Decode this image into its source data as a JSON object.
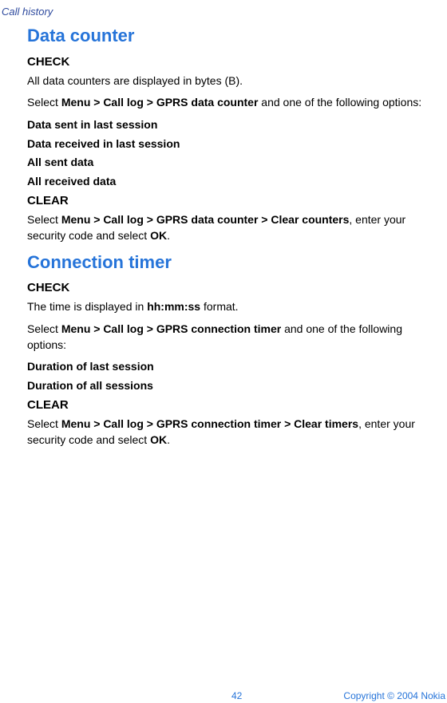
{
  "header": {
    "section": "Call history"
  },
  "s1": {
    "title": "Data counter",
    "check": {
      "heading": "CHECK",
      "body": "All data counters are displayed in bytes (B).",
      "nav_prefix": "Select ",
      "nav_path": "Menu > Call log > GPRS data counter",
      "nav_suffix": " and one of the following options:",
      "opts": [
        "Data sent in last session",
        "Data received in last session",
        "All sent data",
        "All received data"
      ]
    },
    "clear": {
      "heading": "CLEAR",
      "nav_prefix": "Select ",
      "nav_path": "Menu > Call log > GPRS data counter > Clear counters",
      "nav_mid": ", enter your security code and select ",
      "nav_ok": "OK",
      "nav_end": "."
    }
  },
  "s2": {
    "title": "Connection timer",
    "check": {
      "heading": "CHECK",
      "body_prefix": "The time is displayed in ",
      "body_bold": "hh:mm:ss",
      "body_suffix": " format.",
      "nav_prefix": "Select ",
      "nav_path": "Menu > Call log > GPRS connection timer",
      "nav_suffix": " and one of the following options:",
      "opts": [
        "Duration of last session",
        "Duration of all sessions"
      ]
    },
    "clear": {
      "heading": "CLEAR",
      "nav_prefix": "Select ",
      "nav_path": "Menu > Call log > GPRS connection timer > Clear timers",
      "nav_mid": ", enter your security code and select ",
      "nav_ok": "OK",
      "nav_end": "."
    }
  },
  "footer": {
    "page": "42",
    "copyright": "Copyright © 2004 Nokia"
  }
}
